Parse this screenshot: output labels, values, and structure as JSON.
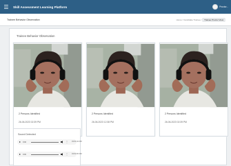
{
  "topbar": {
    "menu_icon": "hamburger-menu-icon",
    "title": "Skill Assessment Learning Platform",
    "user_name": "Proctor..."
  },
  "page": {
    "title": "Trainee Behavior Observation",
    "breadcrumb": [
      "Home",
      "Candidate Trainee",
      "Trainee Proctor View"
    ]
  },
  "panel": {
    "title": "Trainee Behavior Observation",
    "cards": [
      {
        "status": "2 Persons Identified",
        "time": "26-06-2023 02:39 PM"
      },
      {
        "status": "2 Persons Identified",
        "time": "26-06-2023 12:38 PM"
      },
      {
        "status": "2 Persons Identified",
        "time": "26-06-2023 02:39 PM"
      }
    ]
  },
  "sound": {
    "title": "Sound Detected",
    "items": [
      {
        "time": "0:00",
        "label": "03:54:43 PM"
      },
      {
        "time": "0:00",
        "label": "03:54:55 PM"
      }
    ]
  }
}
